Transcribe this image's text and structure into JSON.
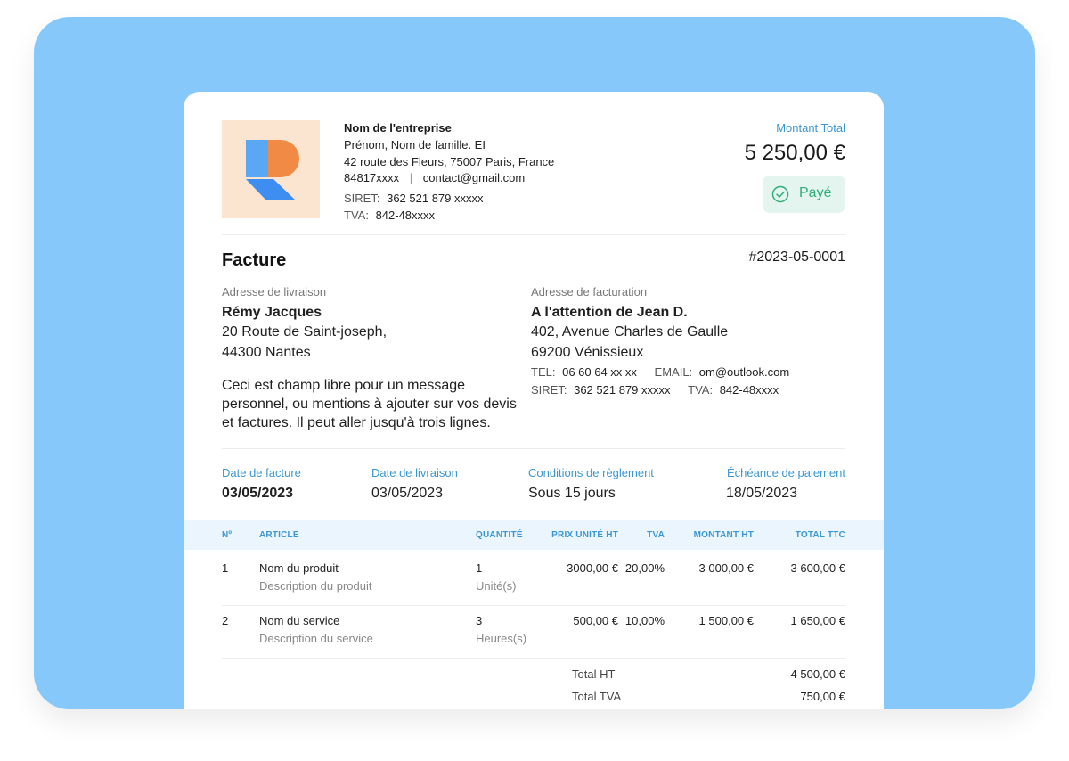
{
  "company": {
    "name": "Nom de l'entreprise",
    "owner": "Prénom, Nom de famille. EI",
    "address": "42 route des Fleurs, 75007 Paris, France",
    "phone": "84817xxxx",
    "separator": "|",
    "email": "contact@gmail.com",
    "siret_label": "SIRET:",
    "siret": "362 521 879 xxxxx",
    "tva_label": "TVA:",
    "tva": "842-48xxxx"
  },
  "total": {
    "label": "Montant Total",
    "amount": "5 250,00 €",
    "status": "Payé"
  },
  "invoice": {
    "title": "Facture",
    "number": "#2023-05-0001"
  },
  "delivery": {
    "label": "Adresse de livraison",
    "name": "Rémy Jacques",
    "line1": "20 Route de Saint-joseph,",
    "line2": "44300 Nantes"
  },
  "message": {
    "line1": "Ceci est champ libre pour un message",
    "line2": "personnel, ou mentions à ajouter sur vos devis",
    "line3": "et factures. Il peut aller jusqu'à trois lignes."
  },
  "billing": {
    "label": "Adresse de facturation",
    "name": "A l'attention de Jean D.",
    "line1": "402, Avenue Charles de Gaulle",
    "line2": "69200 Vénissieux",
    "tel_label": "TEL:",
    "tel": "06 60 64 xx xx",
    "email_label": "EMAIL:",
    "email": "om@outlook.com",
    "siret_label": "SIRET:",
    "siret": "362 521 879 xxxxx",
    "tva_label": "TVA:",
    "tva": "842-48xxxx"
  },
  "dates": {
    "invoice_label": "Date de facture",
    "invoice": "03/05/2023",
    "delivery_label": "Date de livraison",
    "delivery": "03/05/2023",
    "terms_label": "Conditions de règlement",
    "terms": "Sous 15 jours",
    "due_label": "Échéance de paiement",
    "due": "18/05/2023"
  },
  "table": {
    "headers": [
      "Nº",
      "ARTICLE",
      "QUANTITÉ",
      "PRIX UNITÉ HT",
      "TVA",
      "MONTANT HT",
      "TOTAL TTC"
    ],
    "rows": [
      {
        "no": "1",
        "name": "Nom du produit",
        "desc": "Description du produit",
        "qty": "1",
        "unit": "Unité(s)",
        "price": "3000,00 €",
        "tva": "20,00%",
        "ht": "3 000,00 €",
        "ttc": "3 600,00 €"
      },
      {
        "no": "2",
        "name": "Nom du service",
        "desc": "Description du service",
        "qty": "3",
        "unit": "Heures(s)",
        "price": "500,00 €",
        "tva": "10,00%",
        "ht": "1 500,00 €",
        "ttc": "1 650,00 €"
      }
    ]
  },
  "totals": {
    "ht_label": "Total HT",
    "ht": "4 500,00 €",
    "tva_label": "Total TVA",
    "tva": "750,00 €"
  },
  "colors": {
    "background": "#86c8fa",
    "accent": "#3b97d3",
    "paid_badge": "#e3f5ee",
    "paid_text": "#2fae7a",
    "logo_orange": "#f08a45",
    "logo_blue": "#3d8ef0"
  }
}
